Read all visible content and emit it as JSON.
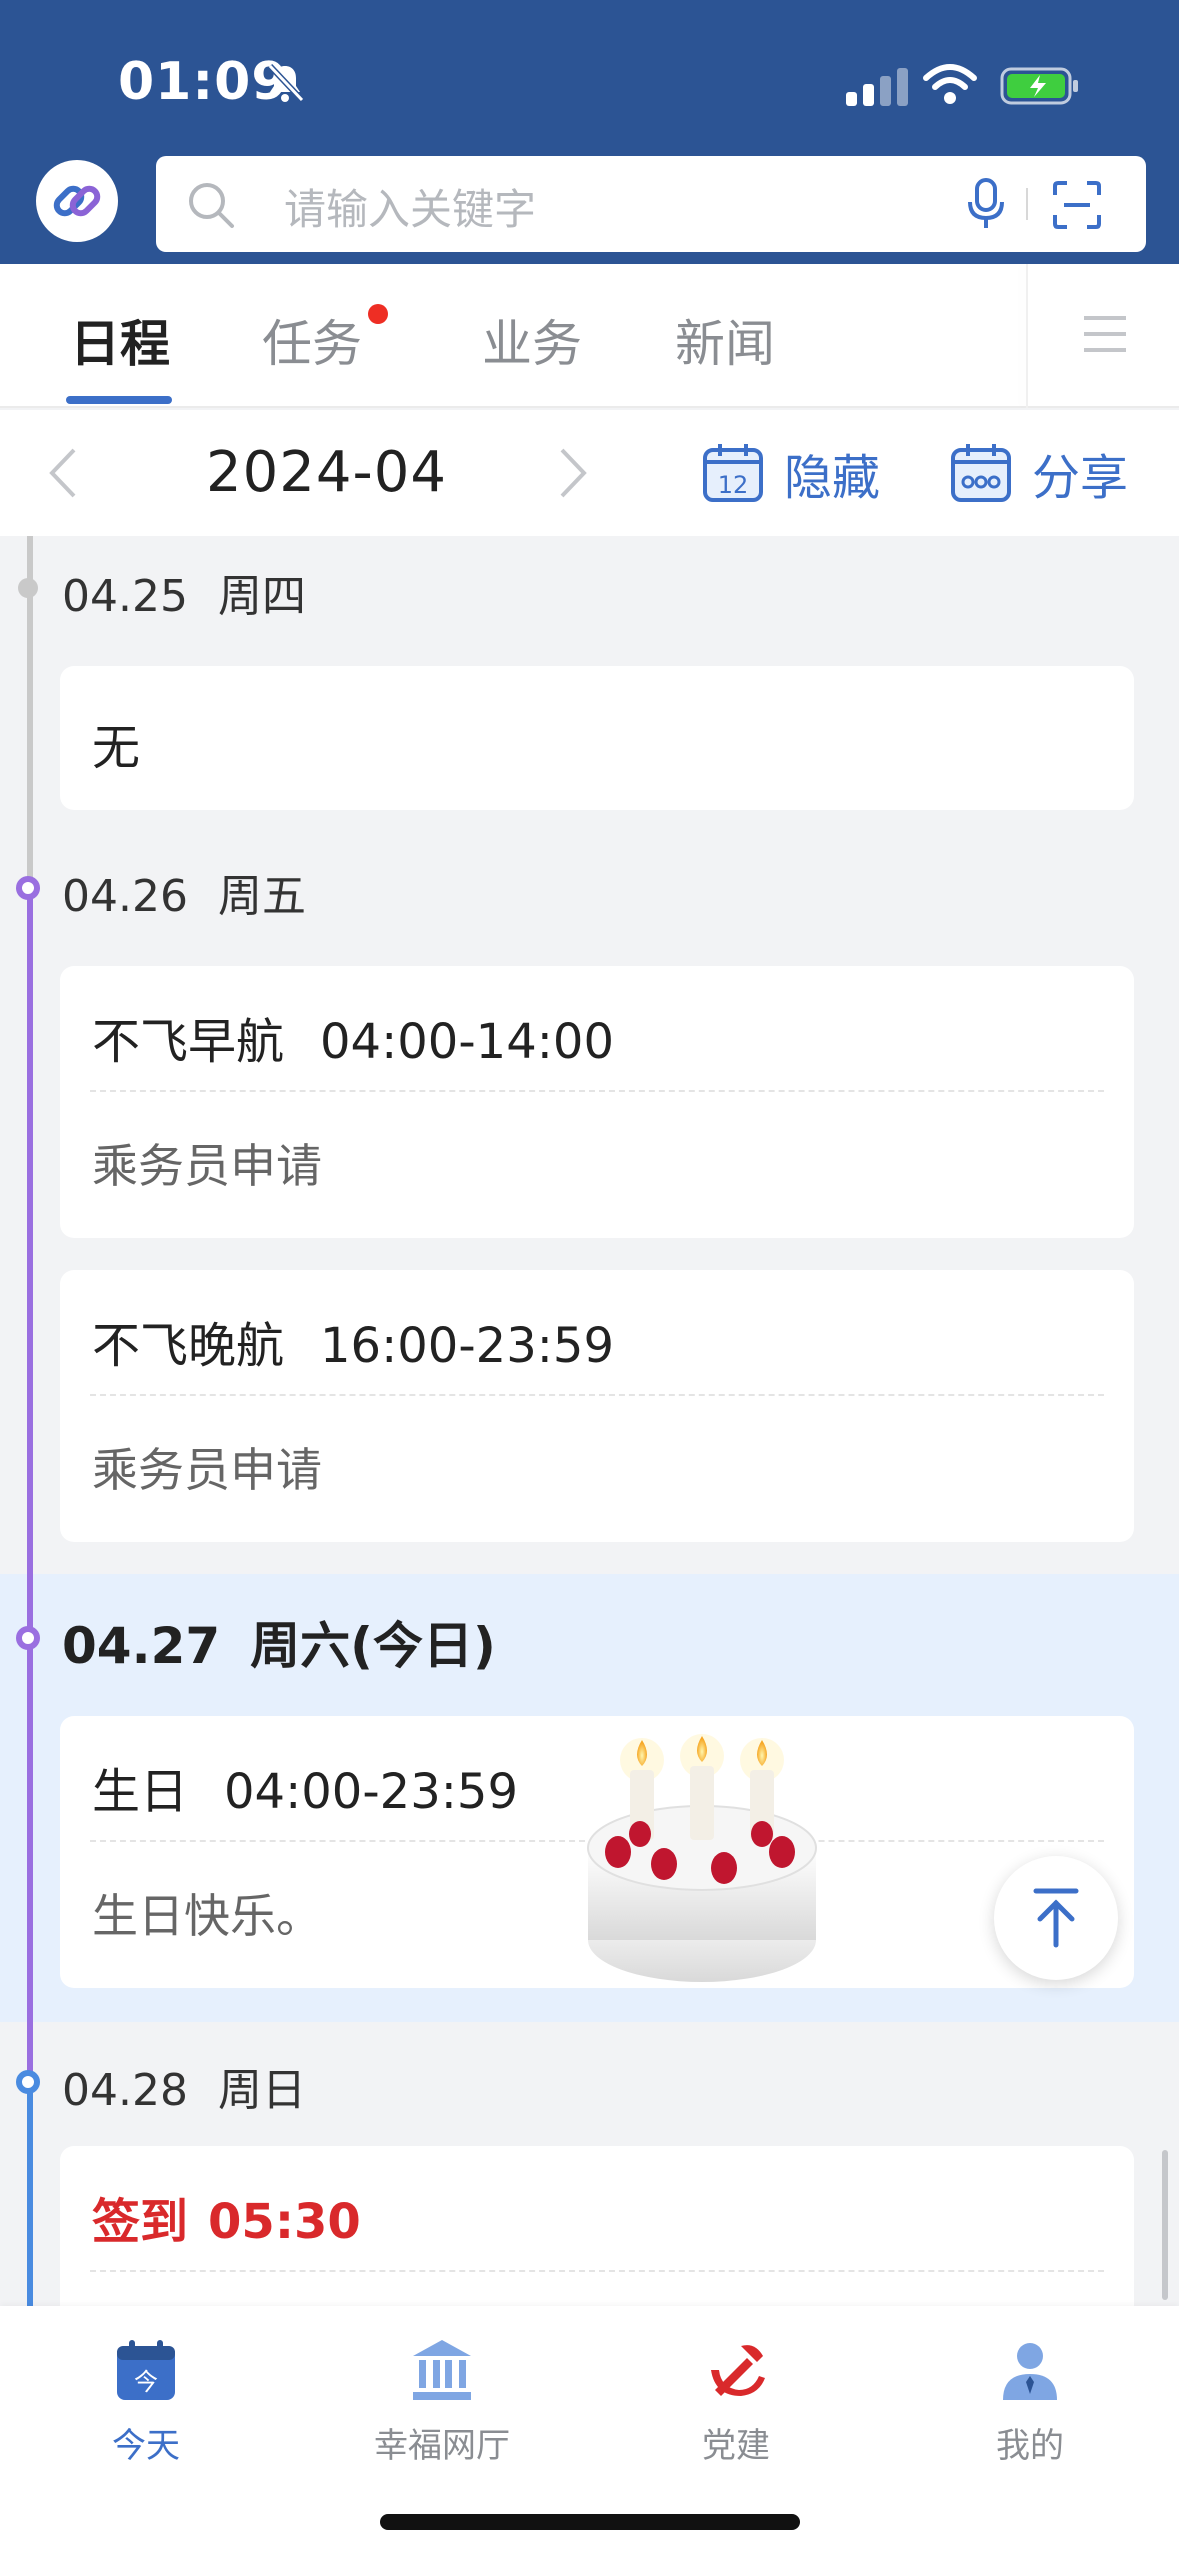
{
  "status_bar": {
    "time": "01:09"
  },
  "search": {
    "placeholder": "请输入关键字"
  },
  "tabs": [
    {
      "label": "日程",
      "active": true
    },
    {
      "label": "任务",
      "badge": true
    },
    {
      "label": "业务"
    },
    {
      "label": "新闻"
    }
  ],
  "month_bar": {
    "month": "2024-04",
    "hide_label": "隐藏",
    "calendar_day": "12",
    "share_label": "分享"
  },
  "days": [
    {
      "date": "04.25",
      "weekday": "周四",
      "cards": [
        {
          "none_text": "无"
        }
      ]
    },
    {
      "date": "04.26",
      "weekday": "周五",
      "cards": [
        {
          "title": "不飞早航",
          "time": "04:00-14:00",
          "desc": "乘务员申请"
        },
        {
          "title": "不飞晚航",
          "time": "16:00-23:59",
          "desc": "乘务员申请"
        }
      ]
    },
    {
      "date": "04.27",
      "weekday": "周六(今日)",
      "today": true,
      "cards": [
        {
          "title": "生日",
          "time": "04:00-23:59",
          "desc": "生日快乐。"
        }
      ]
    },
    {
      "date": "04.28",
      "weekday": "周日",
      "cards": [
        {
          "title": "签到",
          "time": "05:30",
          "highlight": true
        }
      ]
    }
  ],
  "bottom_nav": [
    {
      "label": "今天",
      "icon": "calendar-today-icon",
      "icon_text": "今",
      "active": true
    },
    {
      "label": "幸福网厅",
      "icon": "bank-building-icon"
    },
    {
      "label": "党建",
      "icon": "party-emblem-icon"
    },
    {
      "label": "我的",
      "icon": "profile-icon"
    }
  ],
  "colors": {
    "header": "#2c5494",
    "accent": "#3c6fc8",
    "today_band": "#e6f0fd",
    "checkin": "#d9292b",
    "timeline": "#9a6fe0"
  }
}
